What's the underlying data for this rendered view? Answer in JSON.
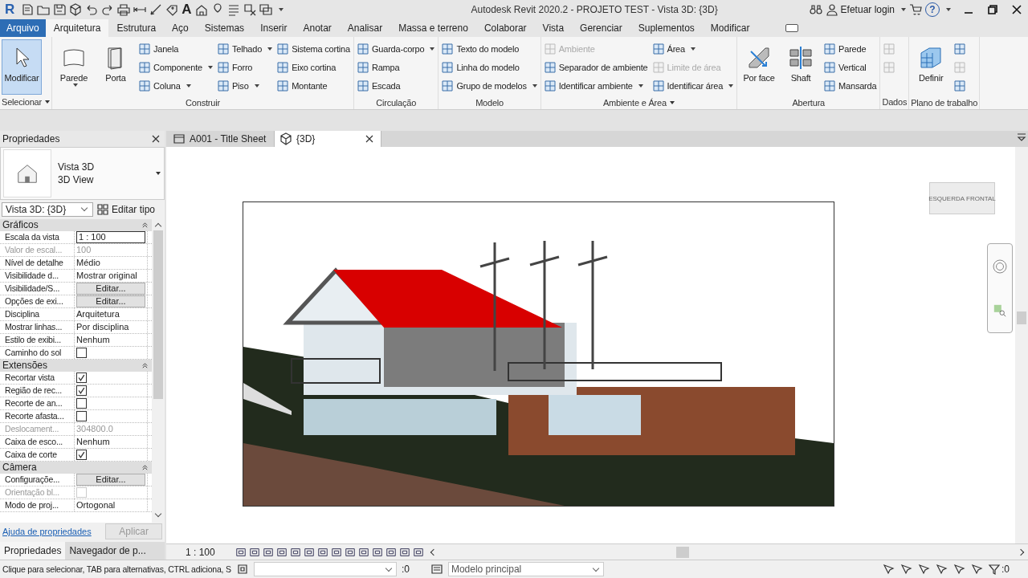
{
  "title_bar": {
    "logo": "R",
    "text_tool": "A",
    "title": "Autodesk Revit 2020.2 - PROJETO TEST - Vista 3D: {3D}",
    "login": "Efetuar login",
    "help": "?"
  },
  "ribbon_tabs": [
    {
      "label": "Arquivo",
      "kind": "file",
      "selected": false
    },
    {
      "label": "Arquitetura",
      "kind": "tab",
      "selected": true
    },
    {
      "label": "Estrutura",
      "kind": "tab",
      "selected": false
    },
    {
      "label": "Aço",
      "kind": "tab",
      "selected": false
    },
    {
      "label": "Sistemas",
      "kind": "tab",
      "selected": false
    },
    {
      "label": "Inserir",
      "kind": "tab",
      "selected": false
    },
    {
      "label": "Anotar",
      "kind": "tab",
      "selected": false
    },
    {
      "label": "Analisar",
      "kind": "tab",
      "selected": false
    },
    {
      "label": "Massa e terreno",
      "kind": "tab",
      "selected": false
    },
    {
      "label": "Colaborar",
      "kind": "tab",
      "selected": false
    },
    {
      "label": "Vista",
      "kind": "tab",
      "selected": false
    },
    {
      "label": "Gerenciar",
      "kind": "tab",
      "selected": false
    },
    {
      "label": "Suplementos",
      "kind": "tab",
      "selected": false
    },
    {
      "label": "Modificar",
      "kind": "tab",
      "selected": false
    }
  ],
  "ribbon_panels": [
    {
      "title": "Selecionar",
      "menu": true,
      "groups": [
        {
          "kind": "large",
          "label": "Modificar",
          "dropdown": false,
          "selected": true
        }
      ]
    },
    {
      "title": "Construir",
      "menu": false,
      "groups": [
        {
          "kind": "large",
          "label": "Parede",
          "dropdown": true,
          "selected": false
        },
        {
          "kind": "large",
          "label": "Porta",
          "dropdown": false,
          "selected": false
        },
        {
          "kind": "column",
          "items": [
            {
              "label": "Janela",
              "dropdown": false,
              "disabled": false
            },
            {
              "label": "Componente",
              "dropdown": true,
              "disabled": false
            },
            {
              "label": "Coluna",
              "dropdown": true,
              "disabled": false
            }
          ]
        },
        {
          "kind": "column",
          "items": [
            {
              "label": "Telhado",
              "dropdown": true,
              "disabled": false
            },
            {
              "label": "Forro",
              "dropdown": false,
              "disabled": false
            },
            {
              "label": "Piso",
              "dropdown": true,
              "disabled": false
            }
          ]
        },
        {
          "kind": "column",
          "items": [
            {
              "label": "Sistema  cortina",
              "dropdown": false,
              "disabled": false
            },
            {
              "label": "Eixo  cortina",
              "dropdown": false,
              "disabled": false
            },
            {
              "label": "Montante",
              "dropdown": false,
              "disabled": false
            }
          ]
        }
      ]
    },
    {
      "title": "Circulação",
      "menu": false,
      "groups": [
        {
          "kind": "column",
          "items": [
            {
              "label": "Guarda-corpo",
              "dropdown": true,
              "disabled": false
            },
            {
              "label": "Rampa",
              "dropdown": false,
              "disabled": false
            },
            {
              "label": "Escada",
              "dropdown": false,
              "disabled": false
            }
          ]
        }
      ]
    },
    {
      "title": "Modelo",
      "menu": false,
      "groups": [
        {
          "kind": "column",
          "items": [
            {
              "label": "Texto  do  modelo",
              "dropdown": false,
              "disabled": false
            },
            {
              "label": "Linha  do  modelo",
              "dropdown": false,
              "disabled": false
            },
            {
              "label": "Grupo  de  modelos",
              "dropdown": true,
              "disabled": false
            }
          ]
        }
      ]
    },
    {
      "title": "Ambiente e Área",
      "menu": true,
      "groups": [
        {
          "kind": "column",
          "items": [
            {
              "label": "Ambiente",
              "dropdown": false,
              "disabled": true
            },
            {
              "label": "Separador  de ambiente",
              "dropdown": false,
              "disabled": false
            },
            {
              "label": "Identificar  ambiente",
              "dropdown": true,
              "disabled": false
            }
          ]
        },
        {
          "kind": "column",
          "items": [
            {
              "label": "Área",
              "dropdown": true,
              "disabled": false
            },
            {
              "label": "Limite  de área",
              "dropdown": false,
              "disabled": true
            },
            {
              "label": "Identificar  área",
              "dropdown": true,
              "disabled": false
            }
          ]
        }
      ]
    },
    {
      "title": "Abertura",
      "menu": false,
      "groups": [
        {
          "kind": "large",
          "label": "Por face",
          "dropdown": false,
          "selected": false
        },
        {
          "kind": "large",
          "label": "Shaft",
          "dropdown": false,
          "selected": false
        },
        {
          "kind": "column",
          "items": [
            {
              "label": "Parede",
              "dropdown": false,
              "disabled": false
            },
            {
              "label": "Vertical",
              "dropdown": false,
              "disabled": false
            },
            {
              "label": "Mansarda",
              "dropdown": false,
              "disabled": false
            }
          ]
        }
      ]
    },
    {
      "title": "Dados",
      "menu": false,
      "groups": [
        {
          "kind": "column",
          "items": [
            {
              "disabled": true
            },
            {
              "disabled": true
            }
          ]
        }
      ]
    },
    {
      "title": "Plano de trabalho",
      "menu": false,
      "groups": [
        {
          "kind": "large",
          "label": "Definir",
          "dropdown": false,
          "selected": false
        },
        {
          "kind": "column",
          "items": [
            {
              "disabled": false
            },
            {
              "disabled": true
            },
            {
              "disabled": false
            }
          ]
        }
      ]
    }
  ],
  "properties": {
    "title": "Propriedades",
    "type_name": "Vista 3D",
    "type_sub": "3D View",
    "selector": "Vista 3D: {3D}",
    "edit_type": "Editar tipo",
    "sections": [
      {
        "title": "Gráficos",
        "rows": [
          {
            "label": "Escala da vista",
            "kind": "input",
            "value": "1 : 100",
            "disabled": false
          },
          {
            "label": "Valor de escal...",
            "kind": "text",
            "value": "100",
            "disabled": true
          },
          {
            "label": "Nível de detalhe",
            "kind": "text",
            "value": "Médio",
            "disabled": false
          },
          {
            "label": "Visibilidade d...",
            "kind": "text",
            "value": "Mostrar original",
            "disabled": false
          },
          {
            "label": "Visibilidade/S...",
            "kind": "button",
            "value": "Editar...",
            "disabled": false
          },
          {
            "label": "Opções de exi...",
            "kind": "button",
            "value": "Editar...",
            "disabled": false
          },
          {
            "label": "Disciplina",
            "kind": "text",
            "value": "Arquitetura",
            "disabled": false
          },
          {
            "label": "Mostrar linhas...",
            "kind": "text",
            "value": "Por disciplina",
            "disabled": false
          },
          {
            "label": "Estilo de exibi...",
            "kind": "text",
            "value": "Nenhum",
            "disabled": false
          },
          {
            "label": "Caminho do sol",
            "kind": "checkbox",
            "checked": false,
            "disabled": false
          }
        ]
      },
      {
        "title": "Extensões",
        "rows": [
          {
            "label": "Recortar vista",
            "kind": "checkbox",
            "checked": true,
            "disabled": false
          },
          {
            "label": "Região de rec...",
            "kind": "checkbox",
            "checked": true,
            "disabled": false
          },
          {
            "label": "Recorte de an...",
            "kind": "checkbox",
            "checked": false,
            "disabled": false
          },
          {
            "label": "Recorte afasta...",
            "kind": "checkbox",
            "checked": false,
            "disabled": false
          },
          {
            "label": "Deslocament...",
            "kind": "text",
            "value": "304800.0",
            "disabled": true
          },
          {
            "label": "Caixa de esco...",
            "kind": "text",
            "value": "Nenhum",
            "disabled": false
          },
          {
            "label": "Caixa de corte",
            "kind": "checkbox",
            "checked": true,
            "disabled": false
          }
        ]
      },
      {
        "title": "Câmera",
        "rows": [
          {
            "label": "Configuraçõe...",
            "kind": "button",
            "value": "Editar...",
            "disabled": false
          },
          {
            "label": "Orientação bl...",
            "kind": "checkbox",
            "checked": false,
            "disabled": true
          },
          {
            "label": "Modo de proj...",
            "kind": "text",
            "value": "Ortogonal",
            "disabled": false
          }
        ]
      }
    ],
    "help_link": "Ajuda de propriedades",
    "apply": "Aplicar",
    "apply_disabled": true
  },
  "panel_tabs": [
    {
      "label": "Propriedades",
      "selected": true
    },
    {
      "label": "Navegador de p...",
      "selected": false
    }
  ],
  "view_tabs": [
    {
      "label": "A001 - Title Sheet",
      "selected": false
    },
    {
      "label": "{3D}",
      "selected": true
    }
  ],
  "view": {
    "kind": "picture",
    "viewcube_left": "ESQUERDA",
    "viewcube_front": "FRONTAL",
    "scale": "1 : 100"
  },
  "status_bar": {
    "hint": "Clique para selecionar, TAB para alternativas, CTRL adiciona, S",
    "count": ":0",
    "model": "Modelo principal",
    "filter_count": ":0"
  }
}
